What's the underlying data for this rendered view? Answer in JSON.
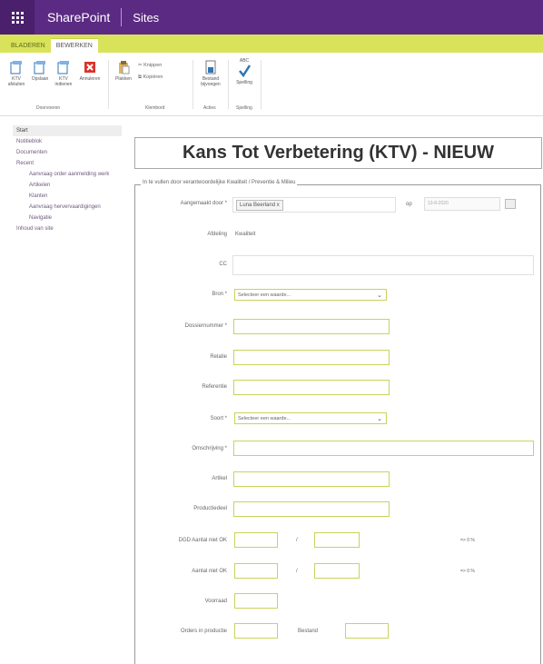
{
  "topbar": {
    "brand": "SharePoint",
    "sites": "Sites"
  },
  "tabs": [
    {
      "label": "BLADEREN"
    },
    {
      "label": "BEWERKEN"
    }
  ],
  "ribbon": {
    "commit": {
      "buttons": [
        "KTV afsluiten",
        "Opslaan",
        "KTV indienen",
        "Annuleren"
      ],
      "label": "Doorvoeren"
    },
    "clipboard": {
      "plakken": "Plakken",
      "knippen": "Knippen",
      "kopieren": "Kopiëren",
      "label": "Klembord"
    },
    "actions": {
      "button": "Bestand bijvoegen",
      "label": "Acties"
    },
    "spelling": {
      "abc": "ABC",
      "button": "Spelling",
      "label": "Spelling"
    }
  },
  "nav": {
    "items": [
      "Start",
      "Notitieblok",
      "Documenten",
      "Recent"
    ],
    "sub": [
      "Aanvraag order aanmelding werk",
      "Artikelen",
      "Klanten",
      "Aanvraag hervervaardigingen",
      "Navigatie"
    ],
    "last": "Inhoud van site"
  },
  "form": {
    "title": "Kans Tot Verbetering (KTV) - NIEUW",
    "legend": "In te vullen door verantwoordelijke Kwaliteit / Preventie & Milieu",
    "labels": {
      "aangemaakt": "Aangemaakt door *",
      "op": "op",
      "afdeling": "Afdeling",
      "cc": "CC",
      "bron": "Bron *",
      "dossier": "Dossiernummer *",
      "relatie": "Relatie",
      "referentie": "Referentie",
      "soort": "Soort *",
      "omschrijving": "Omschrijving *",
      "artikel": "Artikel",
      "productiedeel": "Productiedeel",
      "dgd": "DGD Aantal niet OK",
      "aantal": "Aantal niet OK",
      "voorraad": "Voorraad",
      "orders": "Orders in productie",
      "bestand": "Bestand"
    },
    "values": {
      "aangemaakt_person": "Luna Beerland",
      "date": "13-8-2020",
      "afdeling": "Kwaliteit",
      "bron_select": "Selecteer een waarde...",
      "soort_select": "Selecteer een waarde...",
      "slash": "/",
      "pct1": "=> 0 %",
      "pct2": "=> 0 %"
    }
  }
}
